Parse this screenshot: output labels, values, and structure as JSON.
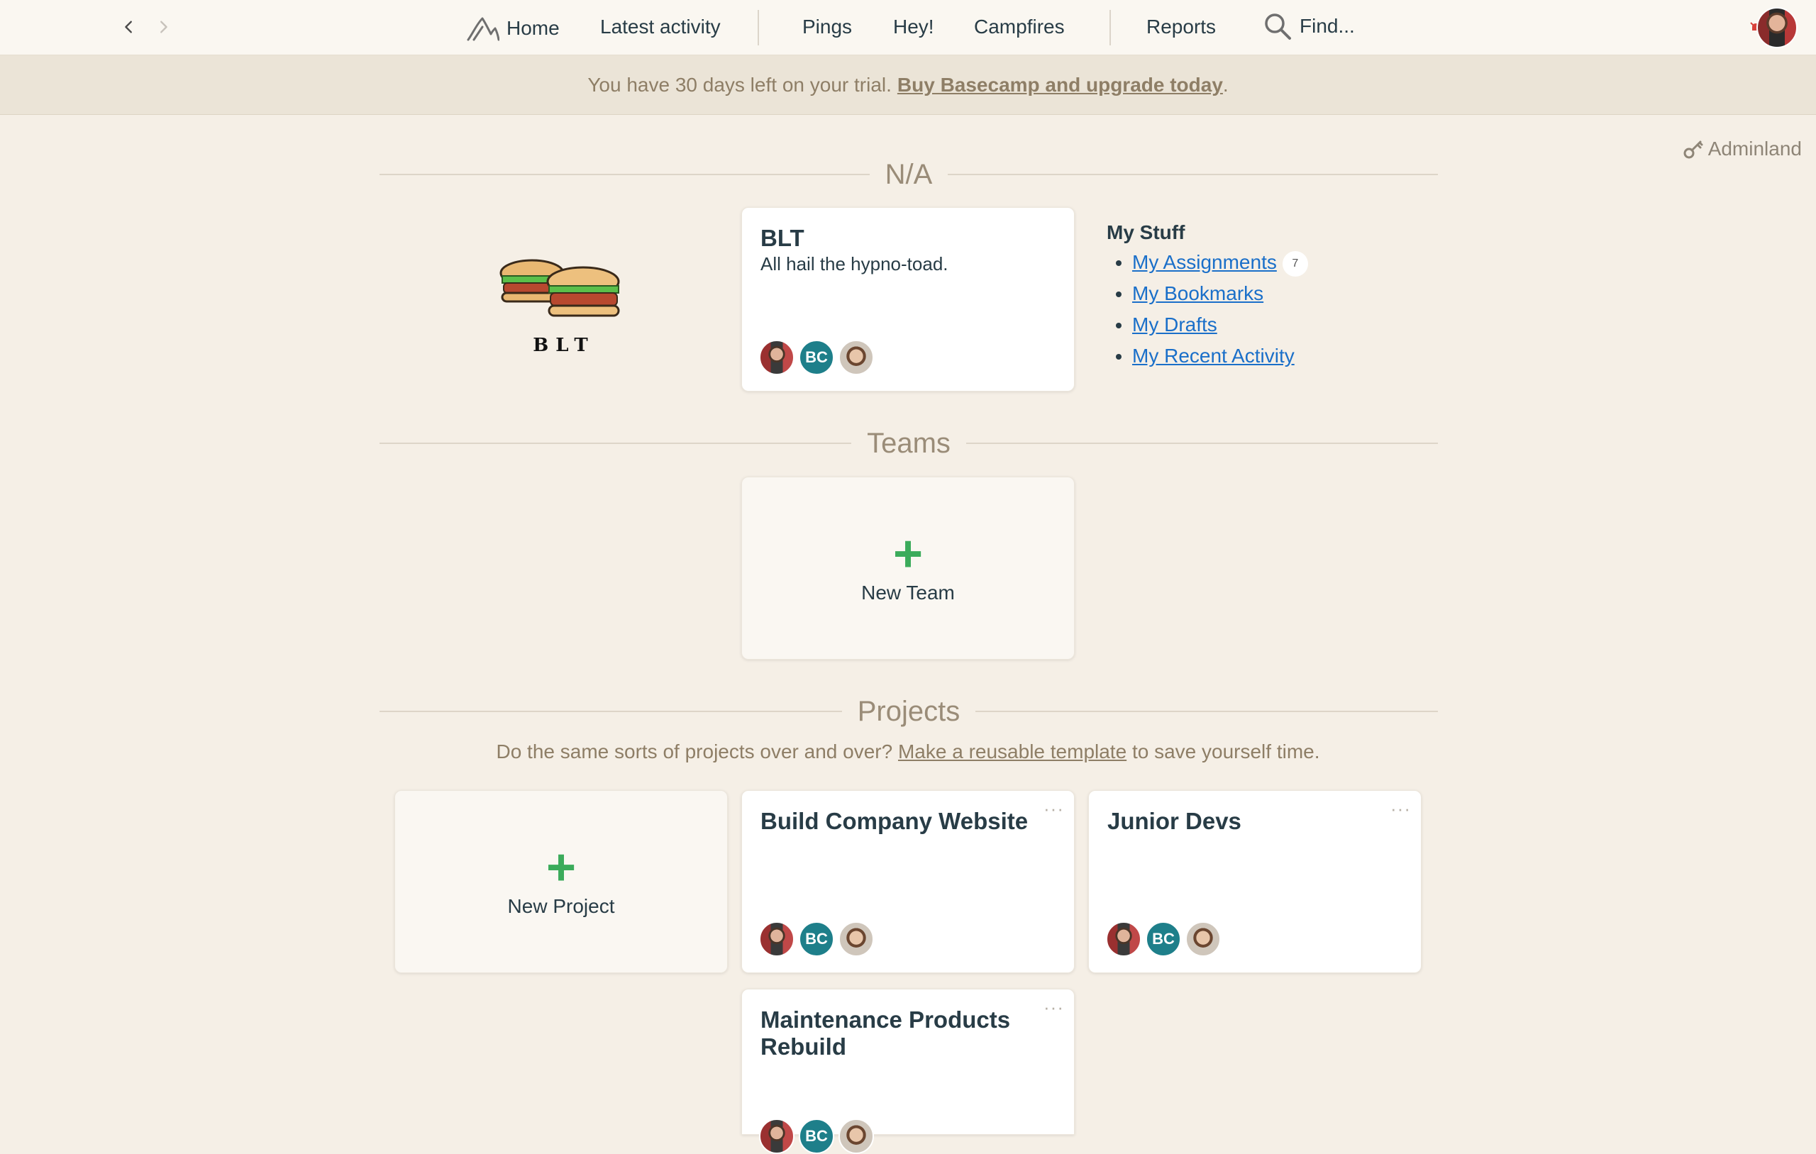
{
  "nav": {
    "back_icon": "chevron-left-icon",
    "forward_icon": "chevron-right-icon",
    "items": [
      {
        "label": "Home",
        "icon": "home-mountain-icon"
      },
      {
        "label": "Latest activity"
      },
      {
        "label": "Pings"
      },
      {
        "label": "Hey!"
      },
      {
        "label": "Campfires"
      },
      {
        "label": "Reports"
      },
      {
        "label": "Find...",
        "icon": "search-icon"
      }
    ]
  },
  "trial": {
    "text": "You have 30 days left on your trial.",
    "link": "Buy Basecamp and upgrade today",
    "suffix": "."
  },
  "adminland": {
    "label": "Adminland",
    "icon": "key-icon"
  },
  "sections": {
    "company": "N/A",
    "teams": "Teams",
    "projects": "Projects"
  },
  "company": {
    "logo_text": "BLT",
    "card_title": "BLT",
    "card_desc": "All hail the hypno-toad.",
    "avatar_initials": "BC"
  },
  "my_stuff": {
    "heading": "My Stuff",
    "items": [
      {
        "label": "My Assignments",
        "count": "7"
      },
      {
        "label": "My Bookmarks"
      },
      {
        "label": "My Drafts"
      },
      {
        "label": "My Recent Activity"
      }
    ]
  },
  "teams": {
    "new_label": "New Team"
  },
  "projects": {
    "hint_before": "Do the same sorts of projects over and over?",
    "hint_link": "Make a reusable template",
    "hint_after": "to save yourself time.",
    "new_label": "New Project",
    "menu_glyph": "···",
    "items": [
      {
        "title": "Build Company Website",
        "avatar_initials": "BC"
      },
      {
        "title": "Junior Devs",
        "avatar_initials": "BC"
      },
      {
        "title": "Maintenance Products Rebuild",
        "avatar_initials": "BC"
      }
    ]
  },
  "colors": {
    "background": "#f5efe6",
    "accent_green": "#3bab5b",
    "link_blue": "#1a6fc9",
    "avatar_teal": "#1e7f8a"
  }
}
